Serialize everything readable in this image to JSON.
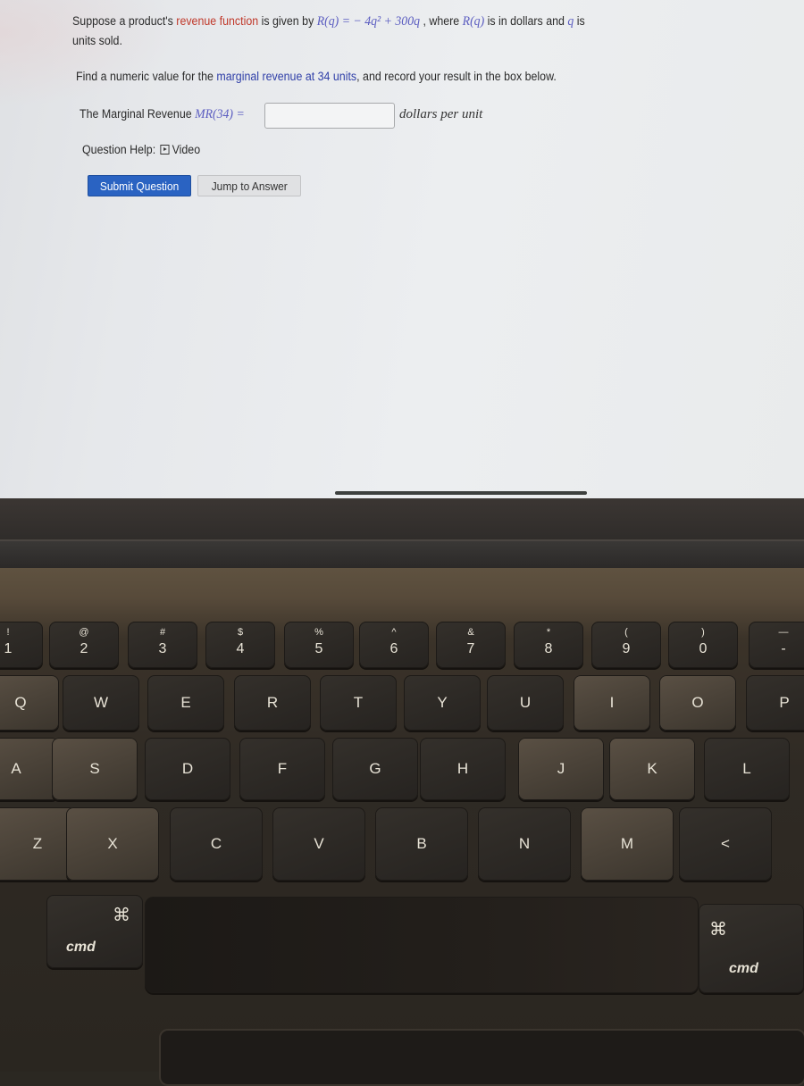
{
  "question": {
    "line1_prefix": "Suppose a product's ",
    "line1_highlight": "revenue function",
    "line1_mid": " is given by ",
    "revenue_lhs": "R(q) = ",
    "revenue_rhs": "− 4q² + 300q",
    "line1_suffix_a": " , where ",
    "line1_rq": "R(q)",
    "line1_suffix_b": " is in dollars and ",
    "line1_q": "q",
    "line1_suffix_c": " is",
    "line2": "units sold.",
    "instruction_prefix": "Find a numeric value for the ",
    "instruction_highlight": "marginal revenue at 34 units",
    "instruction_suffix": ", and record your result in the box below."
  },
  "answer": {
    "label": "The Marginal Revenue ",
    "math_label": "MR(34) =",
    "value": "",
    "placeholder": "",
    "units": "dollars per unit"
  },
  "help": {
    "label": "Question Help:",
    "video_label": "Video"
  },
  "buttons": {
    "submit": "Submit Question",
    "jump": "Jump to Answer"
  },
  "colors": {
    "submit_bg": "#2a63c2",
    "highlight_red": "#c0392b",
    "highlight_blue": "#2f3fa8",
    "math": "#5a5cc0"
  },
  "keyboard": {
    "number_row": [
      {
        "top": "!",
        "main": "1"
      },
      {
        "top": "@",
        "main": "2"
      },
      {
        "top": "#",
        "main": "3"
      },
      {
        "top": "$",
        "main": "4"
      },
      {
        "top": "%",
        "main": "5"
      },
      {
        "top": "^",
        "main": "6"
      },
      {
        "top": "&",
        "main": "7"
      },
      {
        "top": "*",
        "main": "8"
      },
      {
        "top": "(",
        "main": "9"
      },
      {
        "top": ")",
        "main": "0"
      },
      {
        "top": "—",
        "main": "-"
      }
    ],
    "row_q": [
      "Q",
      "W",
      "E",
      "R",
      "T",
      "Y",
      "U",
      "I",
      "O",
      "P"
    ],
    "row_a": [
      "A",
      "S",
      "D",
      "F",
      "G",
      "H",
      "J",
      "K",
      "L"
    ],
    "row_z": [
      "Z",
      "X",
      "C",
      "V",
      "B",
      "N",
      "M",
      "<"
    ],
    "cmd_symbol": "⌘",
    "cmd_label": "cmd"
  }
}
